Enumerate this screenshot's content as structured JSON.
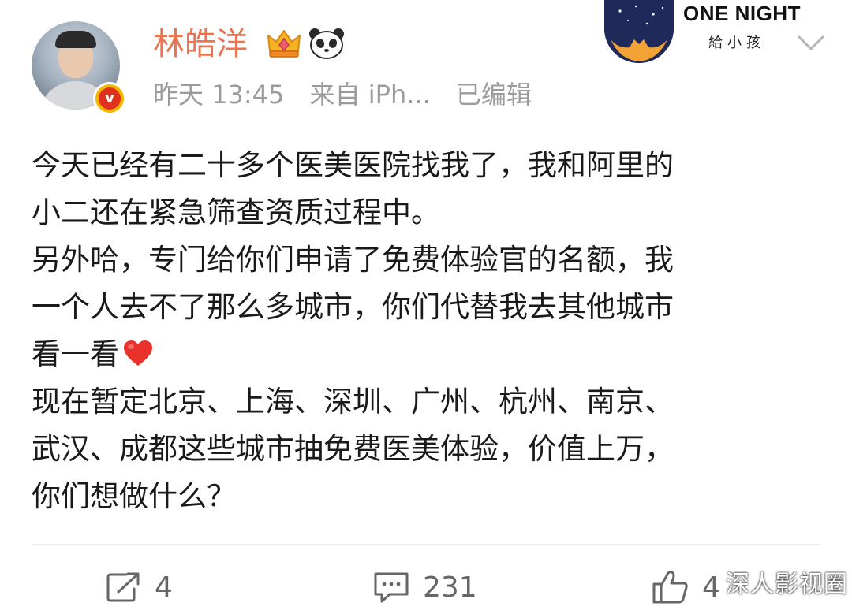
{
  "user": {
    "name": "林皓洋",
    "timestamp": "昨天 13:45",
    "source": "来自 iPh...",
    "edited": "已编辑",
    "verified_mark": "v"
  },
  "brand_card": {
    "title": "ONE NIGHT",
    "subtitle": "給小孩"
  },
  "post": {
    "lines": [
      "今天已经有二十多个医美医院找我了，我和阿里的",
      "小二还在紧急筛查资质过程中。",
      "另外哈，专门给你们申请了免费体验官的名额，我",
      "一个人去不了那么多城市，你们代替我去其他城市",
      "看一看",
      "现在暂定北京、上海、深圳、广州、杭州、南京、",
      "武汉、成都这些城市抽免费医美体验，价值上万，",
      "你们想做什么？"
    ]
  },
  "actions": {
    "share_count": "4",
    "comment_count": "231",
    "like_count": "4"
  },
  "watermark": "深人影视圈",
  "icons": [
    "crown-icon",
    "panda-icon",
    "chevron-down-icon",
    "heart-icon",
    "share-icon",
    "comment-icon",
    "like-icon"
  ],
  "colors": {
    "username": "#eb7350",
    "meta": "#9b9b9b",
    "badge_outer": "#f6b600",
    "badge_inner": "#e0301e",
    "heart": "#e8322b"
  }
}
